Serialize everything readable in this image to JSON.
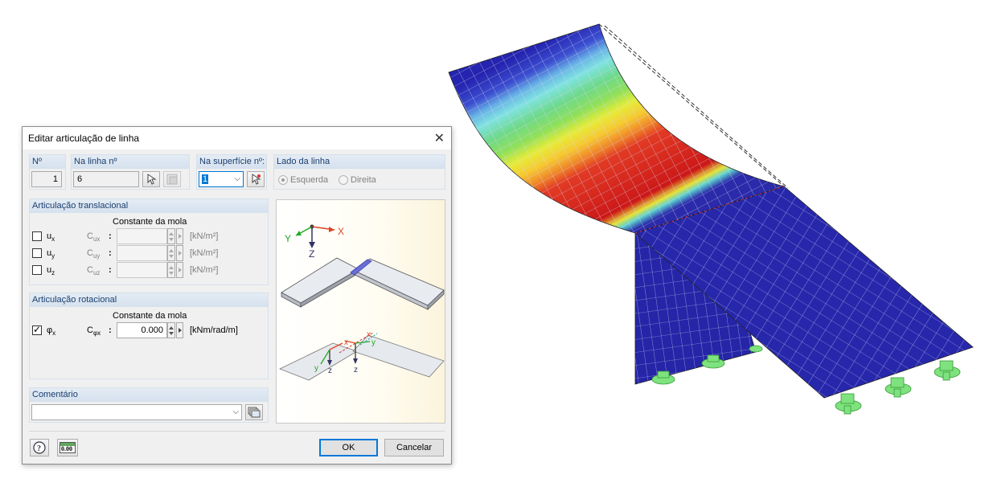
{
  "dialog": {
    "title": "Editar articulação de linha",
    "close_glyph": "✕",
    "no_label": "Nº",
    "no_value": "1",
    "line_label": "Na linha nº",
    "line_value": "6",
    "surface_label": "Na superfície nº:",
    "surface_value": "1",
    "side_label": "Lado da linha",
    "side_left": "Esquerda",
    "side_right": "Direita",
    "trans_label": "Articulação translacional",
    "trans_spring_header": "Constante da mola",
    "trans_rows": [
      {
        "name": "u",
        "sub": "x",
        "const": "C",
        "const_sub": "ux",
        "unit": "[kN/m²]",
        "checked": false
      },
      {
        "name": "u",
        "sub": "y",
        "const": "C",
        "const_sub": "uy",
        "unit": "[kN/m²]",
        "checked": false
      },
      {
        "name": "u",
        "sub": "z",
        "const": "C",
        "const_sub": "uz",
        "unit": "[kN/m²]",
        "checked": false
      }
    ],
    "rot_label": "Articulação rotacional",
    "rot_spring_header": "Constante da mola",
    "rot_row": {
      "name": "φ",
      "sub": "x",
      "const": "C",
      "const_sub": "φx",
      "value": "0.000",
      "unit": "[kNm/rad/m]",
      "checked": true
    },
    "comment_label": "Comentário",
    "comment_value": "",
    "colon": ":",
    "ok_label": "OK",
    "cancel_label": "Cancelar",
    "units_icon_text": "0.00"
  },
  "preview_axes": {
    "x": "X",
    "y": "Y",
    "z": "Z"
  },
  "preview_local": {
    "x": "x",
    "y": "y",
    "z": "z"
  },
  "colors": {
    "group_header": "#d5e1ee",
    "group_text": "#1a3e6e",
    "ok_border": "#0078d7",
    "surface_blue": "#2929a8",
    "support_green": "#7ee27e"
  }
}
